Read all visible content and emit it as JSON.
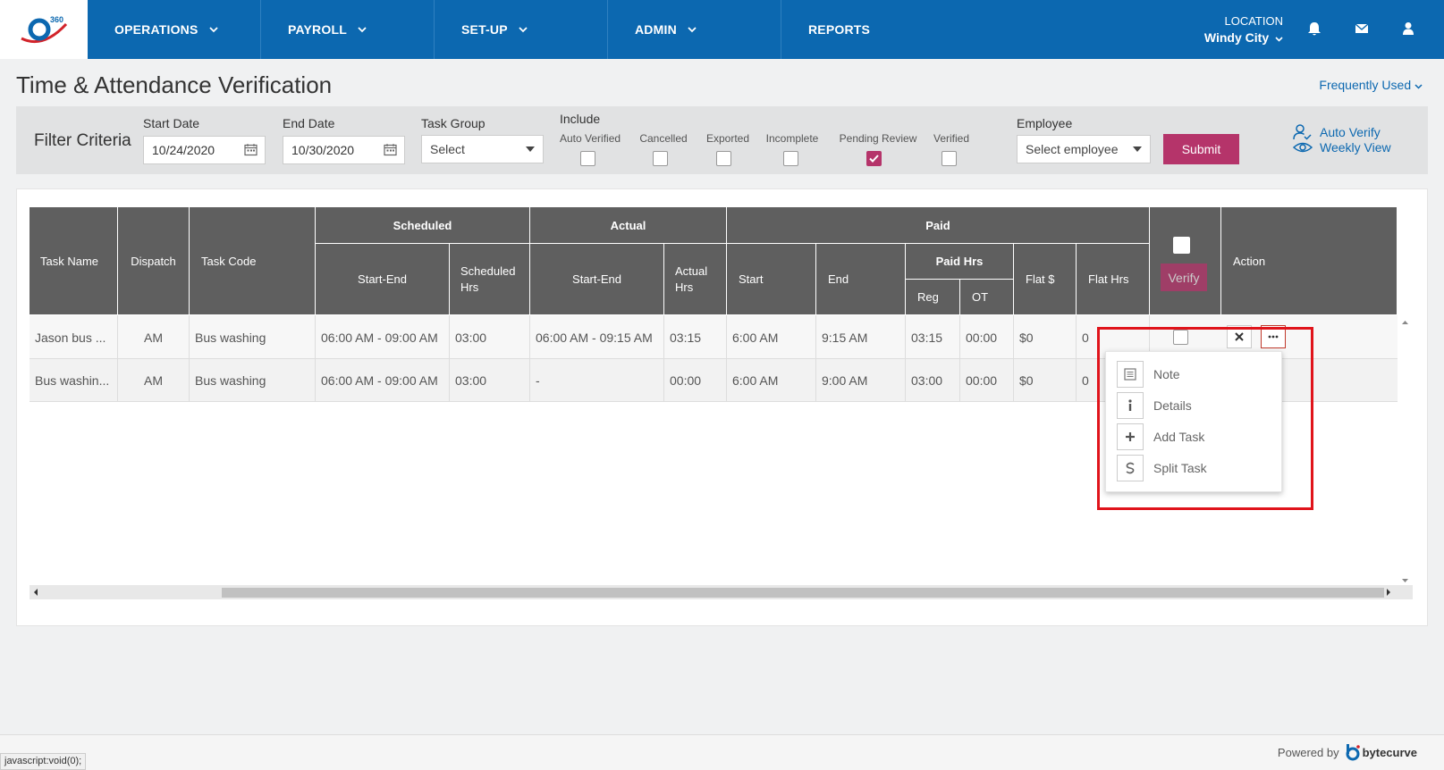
{
  "nav": {
    "items": [
      {
        "label": "OPERATIONS"
      },
      {
        "label": "PAYROLL"
      },
      {
        "label": "SET-UP"
      },
      {
        "label": "ADMIN"
      },
      {
        "label": "REPORTS"
      }
    ],
    "location_label": "LOCATION",
    "location_value": "Windy City",
    "logo_badge": "360"
  },
  "page": {
    "title": "Time & Attendance Verification",
    "frequently_used": "Frequently Used"
  },
  "filter": {
    "title": "Filter Criteria",
    "start_date_label": "Start Date",
    "start_date": "10/24/2020",
    "end_date_label": "End Date",
    "end_date": "10/30/2020",
    "task_group_label": "Task Group",
    "task_group_value": "Select",
    "include_label": "Include",
    "include_options": [
      {
        "label": "Auto Verified",
        "checked": false
      },
      {
        "label": "Cancelled",
        "checked": false
      },
      {
        "label": "Exported",
        "checked": false
      },
      {
        "label": "Incomplete",
        "checked": false
      },
      {
        "label": "Pending Review",
        "checked": true
      },
      {
        "label": "Verified",
        "checked": false
      }
    ],
    "employee_label": "Employee",
    "employee_value": "Select employee",
    "submit": "Submit",
    "auto_verify": "Auto Verify",
    "weekly_view": "Weekly View"
  },
  "table": {
    "headers": {
      "task_name": "Task Name",
      "dispatch": "Dispatch",
      "task_code": "Task Code",
      "scheduled": "Scheduled",
      "actual": "Actual",
      "paid": "Paid",
      "start_end": "Start-End",
      "scheduled_hrs": "Scheduled Hrs",
      "actual_hrs": "Actual Hrs",
      "start": "Start",
      "end": "End",
      "paid_hrs": "Paid Hrs",
      "reg": "Reg",
      "ot": "OT",
      "flat_dollar": "Flat $",
      "flat_hrs": "Flat Hrs",
      "verify": "Verify",
      "action": "Action"
    },
    "rows": [
      {
        "task_name": "Jason bus ...",
        "dispatch": "AM",
        "task_code": "Bus washing",
        "sched": "06:00 AM - 09:00 AM",
        "sched_hrs": "03:00",
        "actual": "06:00 AM - 09:15 AM",
        "actual_hrs": "03:15",
        "start": "6:00 AM",
        "end": "9:15 AM",
        "reg": "03:15",
        "ot": "00:00",
        "flat": "$0",
        "flat_hrs": "0"
      },
      {
        "task_name": "Bus washin...",
        "dispatch": "AM",
        "task_code": "Bus washing",
        "sched": "06:00 AM - 09:00 AM",
        "sched_hrs": "03:00",
        "actual": "-",
        "actual_hrs": "00:00",
        "start": "6:00 AM",
        "end": "9:00 AM",
        "reg": "03:00",
        "ot": "00:00",
        "flat": "$0",
        "flat_hrs": "0"
      }
    ]
  },
  "menu": {
    "items": [
      {
        "label": "Note",
        "icon": "note-icon"
      },
      {
        "label": "Details",
        "icon": "info-icon"
      },
      {
        "label": "Add Task",
        "icon": "plus-icon"
      },
      {
        "label": "Split Task",
        "icon": "split-icon"
      }
    ]
  },
  "footer": {
    "powered_by": "Powered by",
    "brand": "bytecurve",
    "status_text": "javascript:void(0);"
  }
}
